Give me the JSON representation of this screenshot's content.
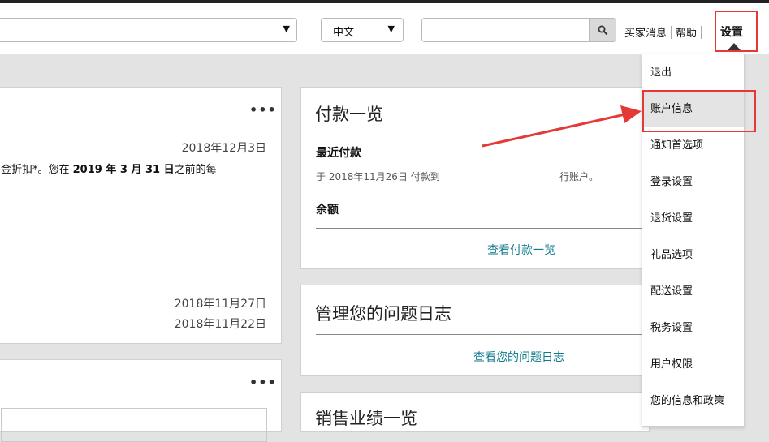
{
  "header": {
    "lang_select": {
      "value": "中文"
    },
    "search": {
      "placeholder": ""
    },
    "links": {
      "buyer_messages": "买家消息",
      "help": "帮助",
      "settings": "设置"
    }
  },
  "left_card_top": {
    "more": "•••",
    "date1": "2018年12月3日",
    "line_pre": "金折扣*。您在 ",
    "line_bold": "2019 年 3 月 31 日",
    "line_post": "之前的每",
    "date2": "2018年11月27日",
    "date3": "2018年11月22日"
  },
  "left_card_bottom": {
    "more": "•••"
  },
  "payments_card": {
    "title": "付款一览",
    "recent_label": "最近付款",
    "recent_line_a": "于 2018年11月26日 付款到",
    "recent_line_b": "行账户。",
    "balance_label": "余额",
    "view_link": "查看付款一览"
  },
  "issues_card": {
    "title": "管理您的问题日志",
    "view_link": "查看您的问题日志"
  },
  "sales_card": {
    "title": "销售业绩一览"
  },
  "settings_menu": {
    "items": [
      "退出",
      "账户信息",
      "通知首选项",
      "登录设置",
      "退货设置",
      "礼品选项",
      "配送设置",
      "税务设置",
      "用户权限",
      "您的信息和政策"
    ],
    "active_index": 1
  },
  "annotation": {
    "color": "#e53935"
  }
}
